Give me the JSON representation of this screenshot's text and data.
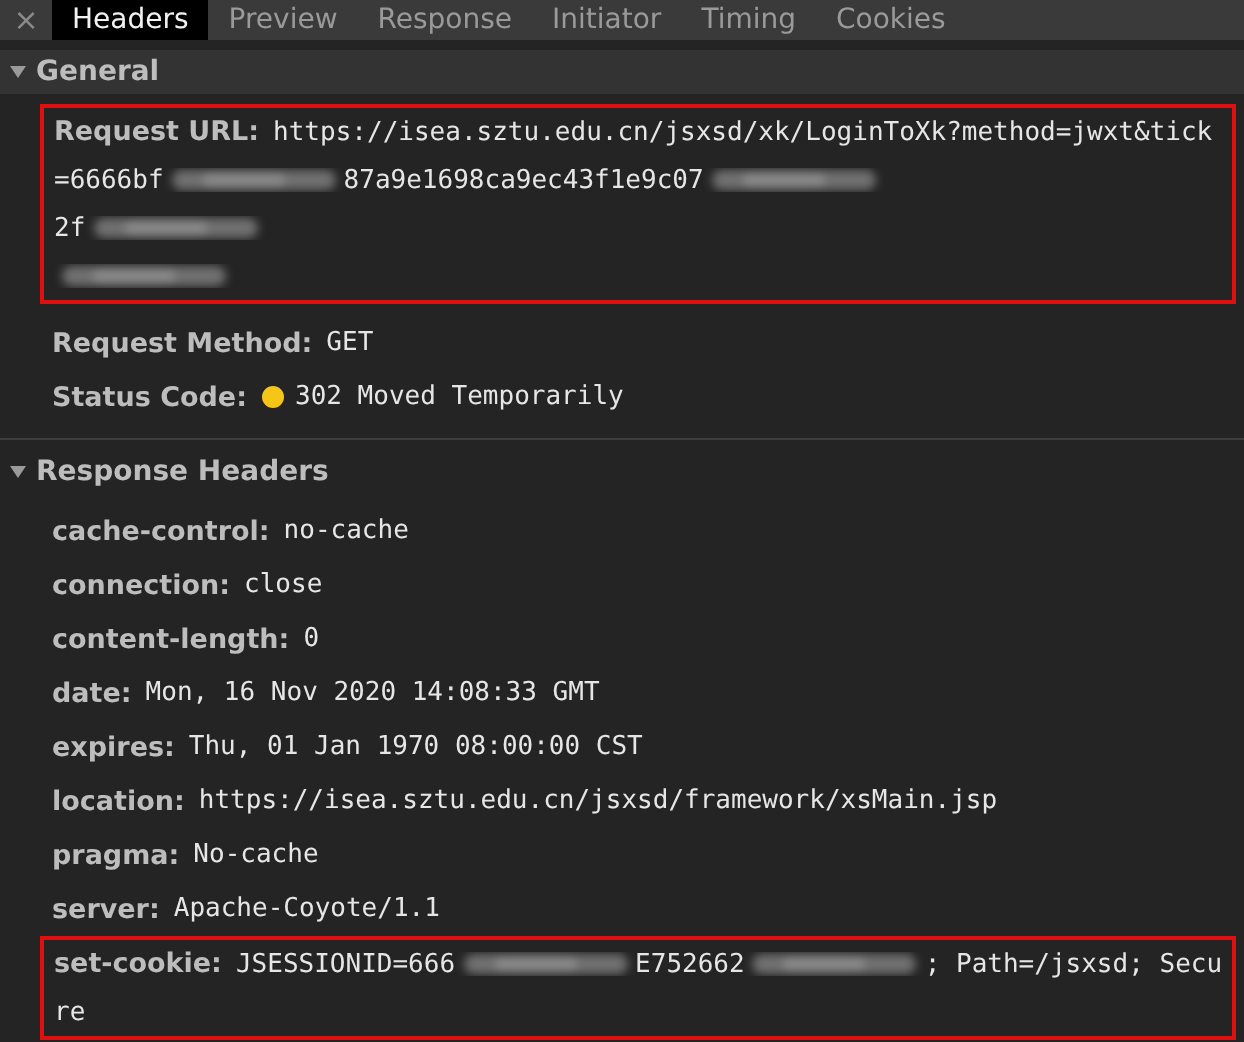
{
  "tabs": [
    {
      "label": "Headers",
      "selected": true
    },
    {
      "label": "Preview",
      "selected": false
    },
    {
      "label": "Response",
      "selected": false
    },
    {
      "label": "Initiator",
      "selected": false
    },
    {
      "label": "Timing",
      "selected": false
    },
    {
      "label": "Cookies",
      "selected": false
    }
  ],
  "close": "×",
  "sections": [
    {
      "title": "General",
      "expanded": true,
      "shaded": true,
      "rows": [
        {
          "name": "Request URL:",
          "highlighted": true,
          "lines": [
            [
              {
                "kind": "text",
                "text": "https://isea.sztu.edu.cn/jsxsd/xk/LoginToXk?method=jwxt&tick"
              }
            ],
            [
              {
                "kind": "text",
                "text": "=6666bf"
              },
              {
                "kind": "redacted"
              },
              {
                "kind": "text",
                "text": "87a9e1698ca9ec43f1e9c07"
              },
              {
                "kind": "redacted"
              }
            ],
            [
              {
                "kind": "text",
                "text": "2f"
              },
              {
                "kind": "redacted"
              }
            ],
            [
              {
                "kind": "redacted"
              }
            ]
          ]
        },
        {
          "name": "Request Method:",
          "highlighted": false,
          "lines": [
            [
              {
                "kind": "text",
                "text": "GET"
              }
            ]
          ]
        },
        {
          "name": "Status Code:",
          "highlighted": false,
          "color": "#f5c518",
          "lines": [
            [
              {
                "kind": "text",
                "text": "302 Moved Temporarily"
              }
            ]
          ]
        }
      ]
    },
    {
      "title": "Response Headers",
      "expanded": true,
      "shaded": false,
      "rows": [
        {
          "name": "cache-control:",
          "highlighted": false,
          "lines": [
            [
              {
                "kind": "text",
                "text": "no-cache"
              }
            ]
          ]
        },
        {
          "name": "connection:",
          "highlighted": false,
          "lines": [
            [
              {
                "kind": "text",
                "text": "close"
              }
            ]
          ]
        },
        {
          "name": "content-length:",
          "highlighted": false,
          "lines": [
            [
              {
                "kind": "text",
                "text": "0"
              }
            ]
          ]
        },
        {
          "name": "date:",
          "highlighted": false,
          "lines": [
            [
              {
                "kind": "text",
                "text": "Mon, 16 Nov 2020 14:08:33 GMT"
              }
            ]
          ]
        },
        {
          "name": "expires:",
          "highlighted": false,
          "lines": [
            [
              {
                "kind": "text",
                "text": "Thu, 01 Jan 1970 08:00:00 CST"
              }
            ]
          ]
        },
        {
          "name": "location:",
          "highlighted": false,
          "lines": [
            [
              {
                "kind": "text",
                "text": "https://isea.sztu.edu.cn/jsxsd/framework/xsMain.jsp"
              }
            ]
          ]
        },
        {
          "name": "pragma:",
          "highlighted": false,
          "lines": [
            [
              {
                "kind": "text",
                "text": "No-cache"
              }
            ]
          ]
        },
        {
          "name": "server:",
          "highlighted": false,
          "lines": [
            [
              {
                "kind": "text",
                "text": "Apache-Coyote/1.1"
              }
            ]
          ]
        },
        {
          "name": "set-cookie:",
          "highlighted": true,
          "lines": [
            [
              {
                "kind": "text",
                "text": "JSESSIONID=666"
              },
              {
                "kind": "redacted"
              },
              {
                "kind": "text",
                "text": "E752662"
              },
              {
                "kind": "redacted"
              },
              {
                "kind": "text",
                "text": "; Path=/jsxsd; Secu"
              }
            ],
            [
              {
                "kind": "text",
                "text": "re"
              }
            ]
          ]
        }
      ]
    }
  ]
}
